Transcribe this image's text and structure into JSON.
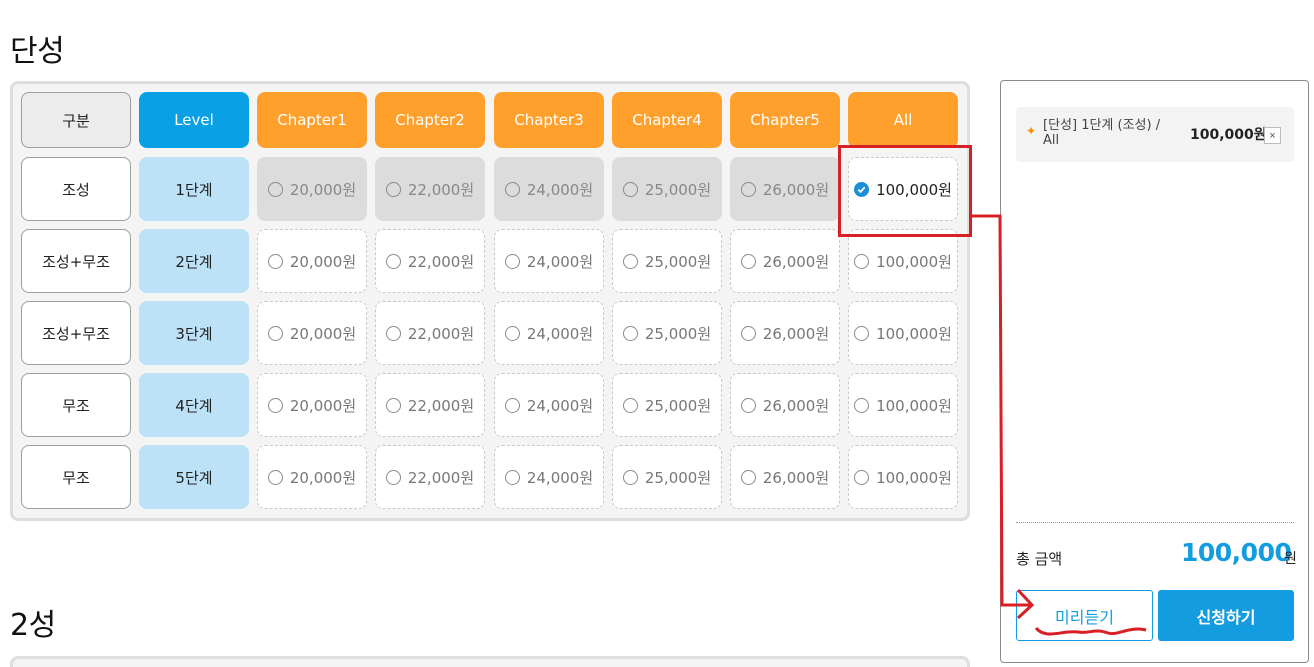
{
  "sections": [
    {
      "title": "단성"
    },
    {
      "title": "2성"
    }
  ],
  "table": {
    "headers": [
      "구분",
      "Level",
      "Chapter1",
      "Chapter2",
      "Chapter3",
      "Chapter4",
      "Chapter5",
      "All"
    ],
    "rows": [
      {
        "category": "조성",
        "level": "1단계",
        "prices": [
          "20,000원",
          "22,000원",
          "24,000원",
          "25,000원",
          "26,000원",
          "100,000원"
        ],
        "state": "selected-all"
      },
      {
        "category": "조성+무조",
        "level": "2단계",
        "prices": [
          "20,000원",
          "22,000원",
          "24,000원",
          "25,000원",
          "26,000원",
          "100,000원"
        ],
        "state": "normal"
      },
      {
        "category": "조성+무조",
        "level": "3단계",
        "prices": [
          "20,000원",
          "22,000원",
          "24,000원",
          "25,000원",
          "26,000원",
          "100,000원"
        ],
        "state": "normal"
      },
      {
        "category": "무조",
        "level": "4단계",
        "prices": [
          "20,000원",
          "22,000원",
          "24,000원",
          "25,000원",
          "26,000원",
          "100,000원"
        ],
        "state": "normal"
      },
      {
        "category": "무조",
        "level": "5단계",
        "prices": [
          "20,000원",
          "22,000원",
          "24,000원",
          "25,000원",
          "26,000원",
          "100,000원"
        ],
        "state": "normal"
      }
    ]
  },
  "cart": {
    "item_text": "[단성] 1단계 (조성) / All",
    "item_price": "100,000원",
    "remove_label": "×",
    "total_label": "총 금액",
    "total_value": "100,000",
    "total_unit": "원",
    "preview_label": "미리듣기",
    "apply_label": "신청하기"
  },
  "colors": {
    "level_blue": "#0aa0e6",
    "chapter_orange": "#ffa02c",
    "accent_blue": "#149ce0",
    "annotation_red": "#d81f26"
  }
}
